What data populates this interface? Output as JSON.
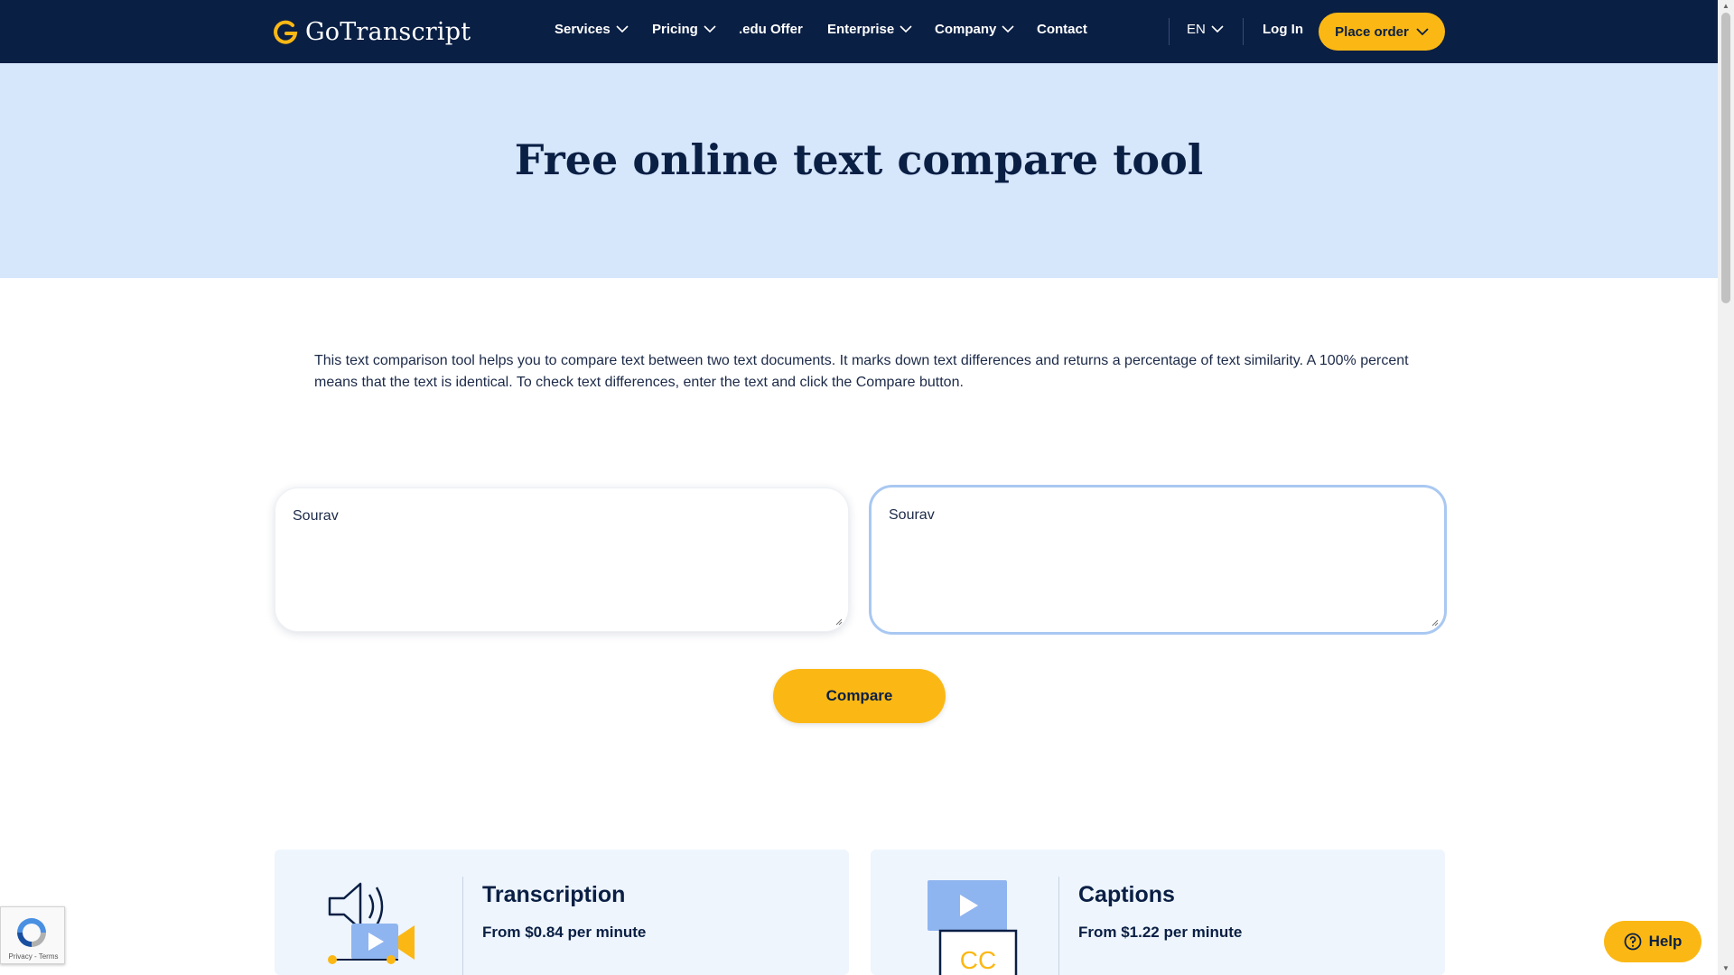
{
  "nav": {
    "logo_text": "GoTranscript",
    "items": [
      {
        "label": "Services",
        "dropdown": true
      },
      {
        "label": "Pricing",
        "dropdown": true
      },
      {
        "label": ".edu Offer",
        "dropdown": false
      },
      {
        "label": "Enterprise",
        "dropdown": true
      },
      {
        "label": "Company",
        "dropdown": true
      },
      {
        "label": "Contact",
        "dropdown": false
      }
    ],
    "language": "EN",
    "login": "Log In",
    "place_order": "Place order"
  },
  "hero": {
    "title": "Free online text compare tool"
  },
  "description": "This text comparison tool helps you to compare text between two text documents. It marks down text differences and returns a percentage of text similarity. A 100% percent means that the text is identical. To check text differences, enter the text and click the Compare button.",
  "compare": {
    "left_text": "Sourav",
    "right_text": "Sourav",
    "button": "Compare"
  },
  "cards": [
    {
      "title": "Transcription",
      "price": "From $0.84 per minute",
      "icon": "speaker-video-icon"
    },
    {
      "title": "Captions",
      "price": "From $1.22 per minute",
      "icon": "cc-video-icon",
      "icon_label": "CC"
    }
  ],
  "recaptcha": {
    "text": "Privacy - Terms"
  },
  "help": {
    "label": "Help"
  },
  "colors": {
    "nav_bg": "#0a1f44",
    "accent": "#fbb814",
    "hero_bg": "#d6e6fb",
    "card_bg": "#eef5fd",
    "focus_border": "#a9c8f2"
  }
}
